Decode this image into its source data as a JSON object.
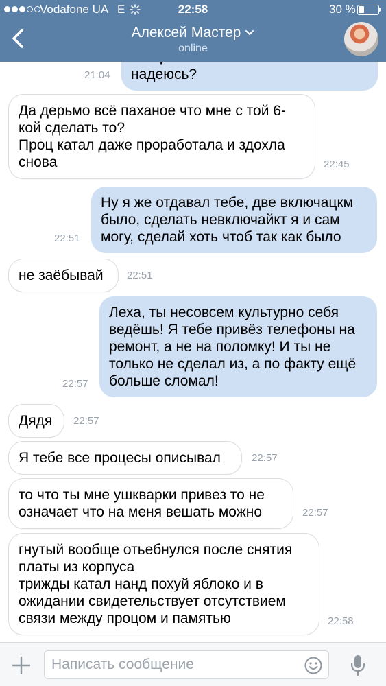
{
  "status": {
    "carrier": "Vodafone UA",
    "network": "E",
    "time": "22:58",
    "battery": "30 %",
    "battery_level": 0.3
  },
  "nav": {
    "title": "Алексей Мастер",
    "subtitle": "online"
  },
  "messages": [
    {
      "dir": "out",
      "text": "которым включался включаться и\nнадеюсь?",
      "time": "21:04"
    },
    {
      "dir": "in",
      "text": "Да дерьмо всё паханое что мне с той 6-\nкой сделать то?\nПроц катал даже проработала и здохла\nснова",
      "time": "22:45"
    },
    {
      "dir": "out",
      "text": "Ну я же отдавал тебе, две включацкм\nбыло, сделать невключайкт я и сам\nмогу, сделай хоть чтоб так как было",
      "time": "22:51"
    },
    {
      "dir": "in",
      "text": "не заёбывай",
      "time": "22:51"
    },
    {
      "dir": "out",
      "text": "Леха, ты несовсем культурно себя\nведёшь! Я тебе привёз телефоны на\nремонт, а не на поломку! И ты не\nтолько не сделал из, а по факту ещё\nбольше сломал!",
      "time": "22:57"
    },
    {
      "dir": "in",
      "text": "Дядя",
      "time": "22:57"
    },
    {
      "dir": "in",
      "text": "Я тебе все процесы описывал",
      "time": "22:57"
    },
    {
      "dir": "in",
      "text": "то что ты мне ушкварки привез то не\nозначает что на меня вешать можно",
      "time": "22:57"
    },
    {
      "dir": "in",
      "text": "гнутый вообще отьебнулся после снятия\nплаты из корпуса\nтрижды катал нанд похуй яблоко и в\nожидании свидетельствует отсутствием\nсвязи между процом и памятью",
      "time": "22:58"
    }
  ],
  "input": {
    "placeholder": "Написать сообщение"
  },
  "colors": {
    "header": "#5a80a8",
    "outgoing_bubble": "#cfe0f4",
    "incoming_bubble": "#ffffff",
    "timestamp": "#99a2ab"
  }
}
